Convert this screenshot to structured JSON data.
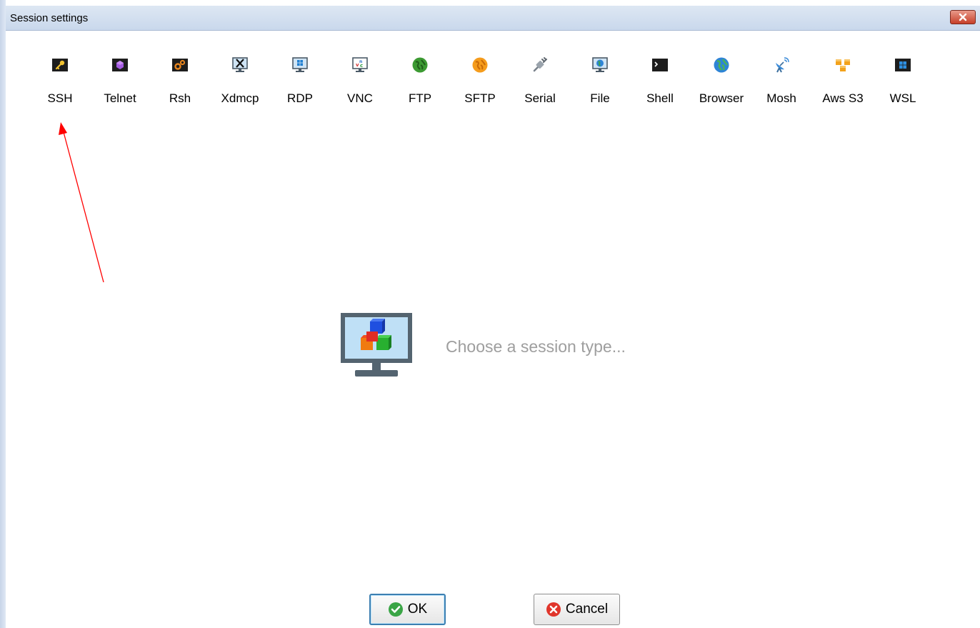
{
  "window": {
    "title": "Session settings"
  },
  "toolbar": {
    "items": [
      {
        "label": "SSH",
        "icon": "key-icon"
      },
      {
        "label": "Telnet",
        "icon": "purple-gem-icon"
      },
      {
        "label": "Rsh",
        "icon": "gears-icon"
      },
      {
        "label": "Xdmcp",
        "icon": "x-monitor-icon"
      },
      {
        "label": "RDP",
        "icon": "windows-monitor-icon"
      },
      {
        "label": "VNC",
        "icon": "vnc-monitor-icon"
      },
      {
        "label": "FTP",
        "icon": "green-globe-icon"
      },
      {
        "label": "SFTP",
        "icon": "orange-globe-icon"
      },
      {
        "label": "Serial",
        "icon": "plug-icon"
      },
      {
        "label": "File",
        "icon": "globe-monitor-icon"
      },
      {
        "label": "Shell",
        "icon": "terminal-icon"
      },
      {
        "label": "Browser",
        "icon": "globe-icon"
      },
      {
        "label": "Mosh",
        "icon": "satellite-dish-icon"
      },
      {
        "label": "Aws S3",
        "icon": "cubes-icon"
      },
      {
        "label": "WSL",
        "icon": "windows-logo-icon"
      }
    ]
  },
  "main": {
    "hint": "Choose a session type..."
  },
  "buttons": {
    "ok_label": "OK",
    "cancel_label": "Cancel"
  },
  "colors": {
    "annotation_arrow": "#ff0000",
    "hint_text": "#9e9e9e",
    "titlebar": "#d3dff0"
  }
}
